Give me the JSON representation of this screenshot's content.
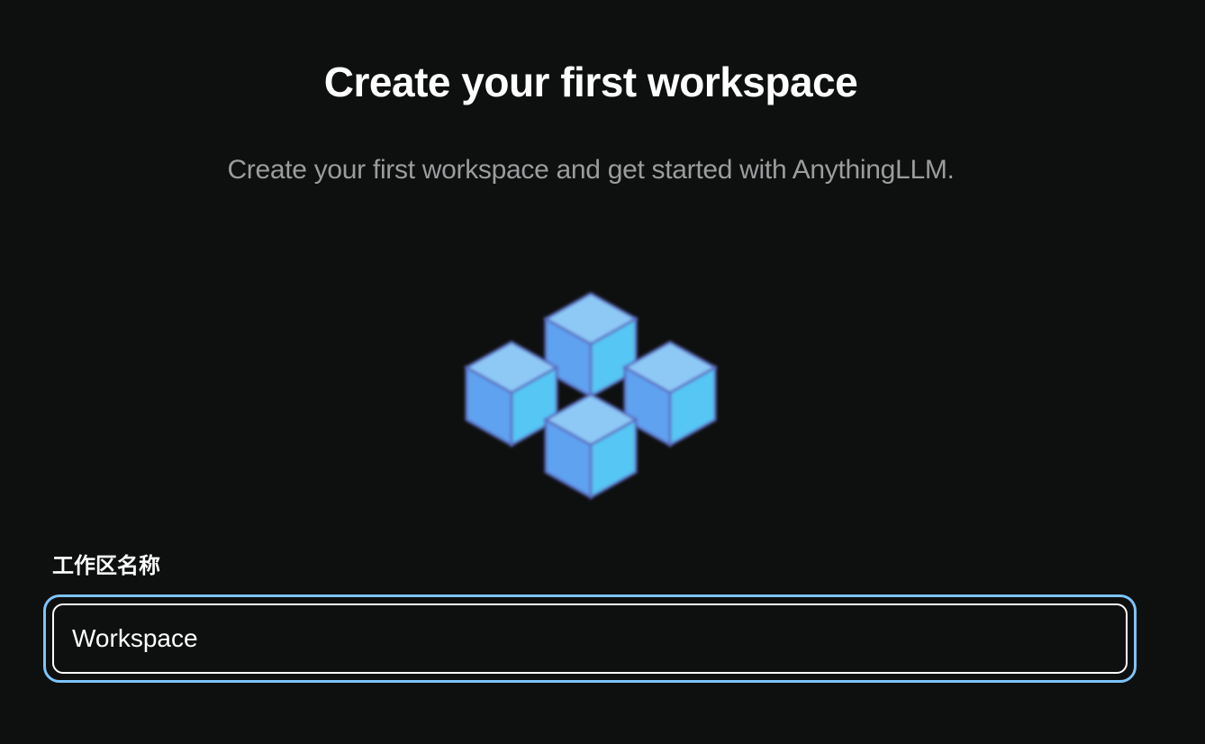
{
  "header": {
    "title": "Create your first workspace",
    "subtitle": "Create your first workspace and get started with AnythingLLM."
  },
  "illustration": {
    "icon": "workspace-cubes-icon",
    "colors": {
      "cube_top": "#8ec9f6",
      "cube_left": "#5ea2f0",
      "cube_right": "#57c6f4",
      "glow": "#5b6fc4"
    }
  },
  "form": {
    "workspace_name_label": "工作区名称",
    "workspace_name_value": "Workspace"
  },
  "colors": {
    "background": "#0e0f0f",
    "focus_ring": "#7cc4fa",
    "subtitle": "#9a9c9d"
  }
}
